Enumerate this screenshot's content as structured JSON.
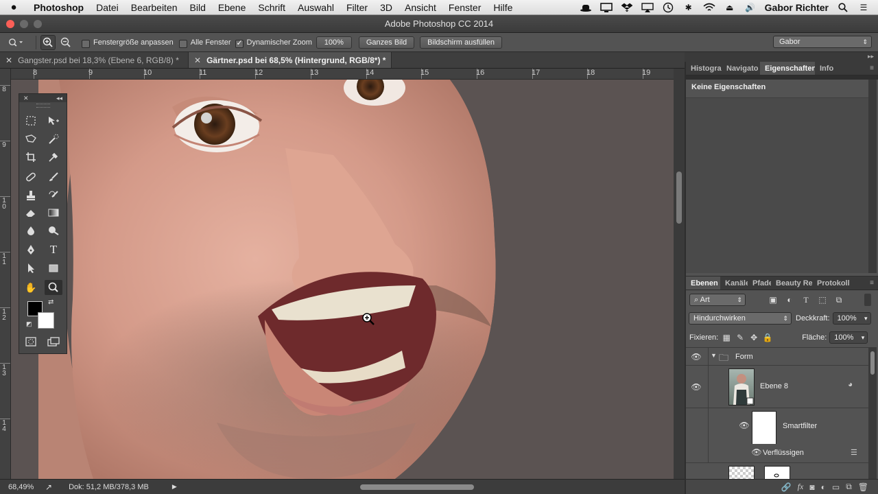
{
  "menubar": {
    "app": "Photoshop",
    "items": [
      "Datei",
      "Bearbeiten",
      "Bild",
      "Ebene",
      "Schrift",
      "Auswahl",
      "Filter",
      "3D",
      "Ansicht",
      "Fenster",
      "Hilfe"
    ],
    "user": "Gabor Richter",
    "status_icons": [
      "hat-icon",
      "monitor-icon",
      "dropbox-icon",
      "airplay-icon",
      "time-machine-icon",
      "bluetooth-icon",
      "wifi-icon",
      "eject-icon",
      "volume-icon"
    ]
  },
  "window": {
    "title": "Adobe Photoshop CC 2014"
  },
  "options": {
    "checkbox_fit_window": "Fenstergröße anpassen",
    "checkbox_all_windows": "Alle Fenster",
    "checkbox_scrubby_zoom": "Dynamischer Zoom",
    "btn_100": "100%",
    "btn_fit_screen": "Ganzes Bild",
    "btn_fill_screen": "Bildschirm ausfüllen",
    "workspace": "Gabor"
  },
  "doctabs": [
    {
      "label": "Gangster.psd bei 18,3% (Ebene 6, RGB/8) *",
      "active": false
    },
    {
      "label": "Gärtner.psd bei 68,5% (Hintergrund, RGB/8*) *",
      "active": true
    }
  ],
  "rulers": {
    "h_labels": [
      "8",
      "9",
      "10",
      "11",
      "12",
      "13",
      "14",
      "15",
      "16",
      "17",
      "18",
      "19"
    ],
    "v_labels": [
      "8",
      "9",
      "10",
      "11",
      "12",
      "13",
      "14"
    ]
  },
  "status": {
    "zoom": "68,49%",
    "doc": "Dok: 51,2 MB/378,3 MB"
  },
  "panels": {
    "top_tabs": [
      "Histogra",
      "Navigato",
      "Eigenschaften",
      "Info"
    ],
    "properties_label": "Keine Eigenschaften",
    "layer_tabs": [
      "Ebenen",
      "Kanäle",
      "Pfade",
      "Beauty Ret",
      "Protokoll"
    ],
    "filter_kind": "Art",
    "blend_mode": "Hindurchwirken",
    "opacity_label": "Deckkraft:",
    "opacity": "100%",
    "lock_label": "Fixieren:",
    "fill_label": "Fläche:",
    "fill": "100%",
    "layers": {
      "group": "Form",
      "layer": "Ebene 8",
      "smartfilter": "Smartfilter",
      "filter": "Verflüssigen"
    }
  }
}
